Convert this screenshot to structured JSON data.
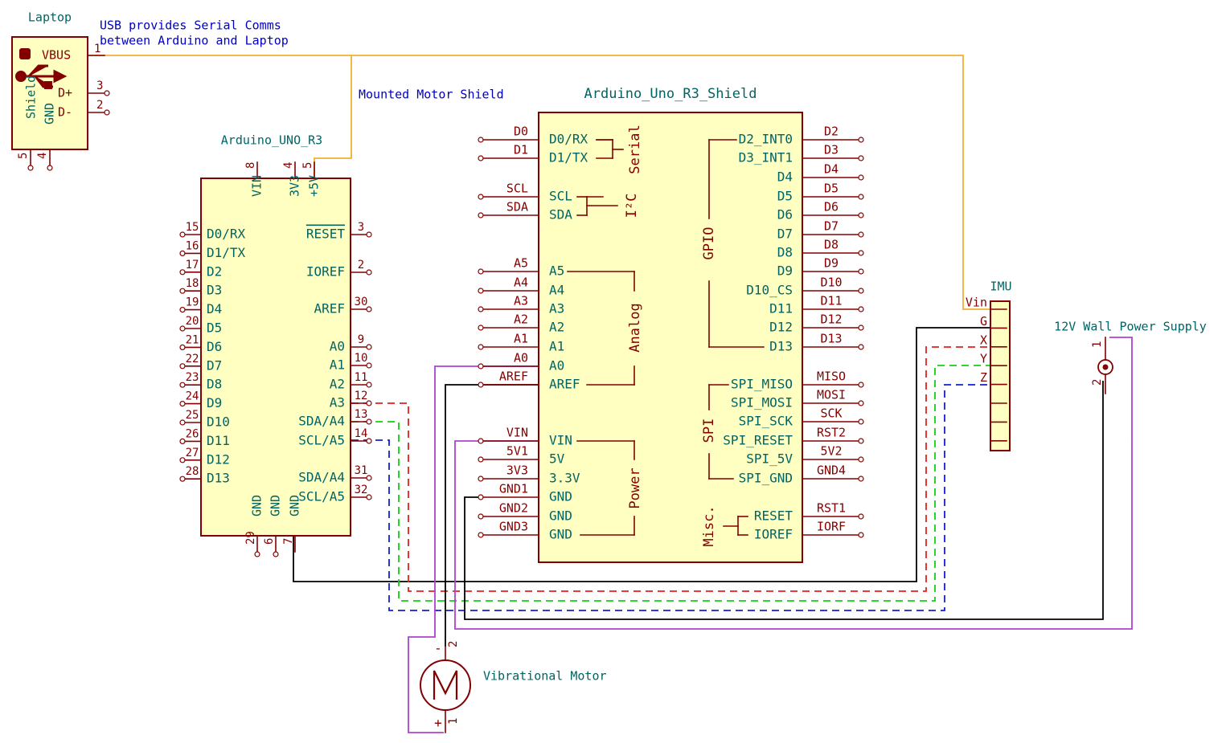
{
  "notes": {
    "usb_comms_line1": "USB provides Serial Comms",
    "usb_comms_line2": "between Arduino and Laptop",
    "mounted_shield": "Mounted Motor Shield",
    "wall_supply": "12V Wall Power Supply",
    "vib_motor": "Vibrational Motor"
  },
  "colors": {
    "body_fill": "#ffffc2",
    "outline": "#840000",
    "teal_text": "#006464",
    "pin_text": "#840000",
    "note_blue": "#0000c2",
    "wire_vbus": "#f0b030",
    "wire_purple": "#b040d0",
    "wire_black": "#000000",
    "wire_red": "#e02020",
    "wire_green": "#10d010",
    "wire_blue": "#1020d0"
  },
  "laptop": {
    "title": "Laptop",
    "pins": [
      {
        "name": "VBUS",
        "num": "1"
      },
      {
        "name": "D+",
        "num": "3"
      },
      {
        "name": "D-",
        "num": "2"
      },
      {
        "name": "Shield",
        "num": "5"
      },
      {
        "name": "GND",
        "num": "4"
      }
    ]
  },
  "uno": {
    "title": "Arduino_UNO_R3",
    "top_pins": [
      {
        "name": "VIN",
        "num": "8"
      },
      {
        "name": "3V3",
        "num": "4"
      },
      {
        "name": "+5V",
        "num": "5"
      }
    ],
    "left_pins": [
      {
        "name": "D0/RX",
        "num": "15"
      },
      {
        "name": "D1/TX",
        "num": "16"
      },
      {
        "name": "D2",
        "num": "17"
      },
      {
        "name": "D3",
        "num": "18"
      },
      {
        "name": "D4",
        "num": "19"
      },
      {
        "name": "D5",
        "num": "20"
      },
      {
        "name": "D6",
        "num": "21"
      },
      {
        "name": "D7",
        "num": "22"
      },
      {
        "name": "D8",
        "num": "23"
      },
      {
        "name": "D9",
        "num": "24"
      },
      {
        "name": "D10",
        "num": "25"
      },
      {
        "name": "D11",
        "num": "26"
      },
      {
        "name": "D12",
        "num": "27"
      },
      {
        "name": "D13",
        "num": "28"
      }
    ],
    "right_pins": [
      {
        "name": "RESET",
        "num": "3"
      },
      {
        "name": "IOREF",
        "num": "2"
      },
      {
        "name": "AREF",
        "num": "30"
      },
      {
        "name": "A0",
        "num": "9"
      },
      {
        "name": "A1",
        "num": "10"
      },
      {
        "name": "A2",
        "num": "11"
      },
      {
        "name": "A3",
        "num": "12"
      },
      {
        "name": "SDA/A4",
        "num": "13"
      },
      {
        "name": "SCL/A5",
        "num": "14"
      },
      {
        "name": "SDA/A4",
        "num": "31"
      },
      {
        "name": "SCL/A5",
        "num": "32"
      }
    ],
    "bottom_pins": [
      {
        "name": "GND",
        "num": "29"
      },
      {
        "name": "GND",
        "num": "6"
      },
      {
        "name": "GND",
        "num": "7"
      }
    ]
  },
  "shield": {
    "title": "Arduino_Uno_R3_Shield",
    "groups": {
      "serial": "Serial",
      "i2c": "I²C",
      "analog": "Analog",
      "power": "Power",
      "gpio": "GPIO",
      "spi": "SPI",
      "misc": "Misc."
    },
    "left_pins": [
      {
        "net": "D0",
        "name": "D0/RX"
      },
      {
        "net": "D1",
        "name": "D1/TX"
      },
      {
        "net": "SCL",
        "name": "SCL"
      },
      {
        "net": "SDA",
        "name": "SDA"
      },
      {
        "net": "A5",
        "name": "A5"
      },
      {
        "net": "A4",
        "name": "A4"
      },
      {
        "net": "A3",
        "name": "A3"
      },
      {
        "net": "A2",
        "name": "A2"
      },
      {
        "net": "A1",
        "name": "A1"
      },
      {
        "net": "A0",
        "name": "A0"
      },
      {
        "net": "AREF",
        "name": "AREF"
      },
      {
        "net": "VIN",
        "name": "VIN"
      },
      {
        "net": "5V1",
        "name": "5V"
      },
      {
        "net": "3V3",
        "name": "3.3V"
      },
      {
        "net": "GND1",
        "name": "GND"
      },
      {
        "net": "GND2",
        "name": "GND"
      },
      {
        "net": "GND3",
        "name": "GND"
      }
    ],
    "right_pins": [
      {
        "name": "D2_INT0",
        "net": "D2"
      },
      {
        "name": "D3_INT1",
        "net": "D3"
      },
      {
        "name": "D4",
        "net": "D4"
      },
      {
        "name": "D5",
        "net": "D5"
      },
      {
        "name": "D6",
        "net": "D6"
      },
      {
        "name": "D7",
        "net": "D7"
      },
      {
        "name": "D8",
        "net": "D8"
      },
      {
        "name": "D9",
        "net": "D9"
      },
      {
        "name": "D10_CS",
        "net": "D10"
      },
      {
        "name": "D11",
        "net": "D11"
      },
      {
        "name": "D12",
        "net": "D12"
      },
      {
        "name": "D13",
        "net": "D13"
      },
      {
        "name": "SPI_MISO",
        "net": "MISO"
      },
      {
        "name": "SPI_MOSI",
        "net": "MOSI"
      },
      {
        "name": "SPI_SCK",
        "net": "SCK"
      },
      {
        "name": "SPI_RESET",
        "net": "RST2"
      },
      {
        "name": "SPI_5V",
        "net": "5V2"
      },
      {
        "name": "SPI_GND",
        "net": "GND4"
      },
      {
        "name": "RESET",
        "net": "RST1"
      },
      {
        "name": "IOREF",
        "net": "IORF"
      }
    ]
  },
  "imu": {
    "title": "IMU",
    "pins": [
      "Vin",
      "G",
      "X",
      "Y",
      "Z"
    ]
  },
  "supply": {
    "pin1": "1",
    "pin2": "2"
  },
  "motor": {
    "minus": "-",
    "plus": "+",
    "pin2": "2",
    "pin1": "1"
  }
}
